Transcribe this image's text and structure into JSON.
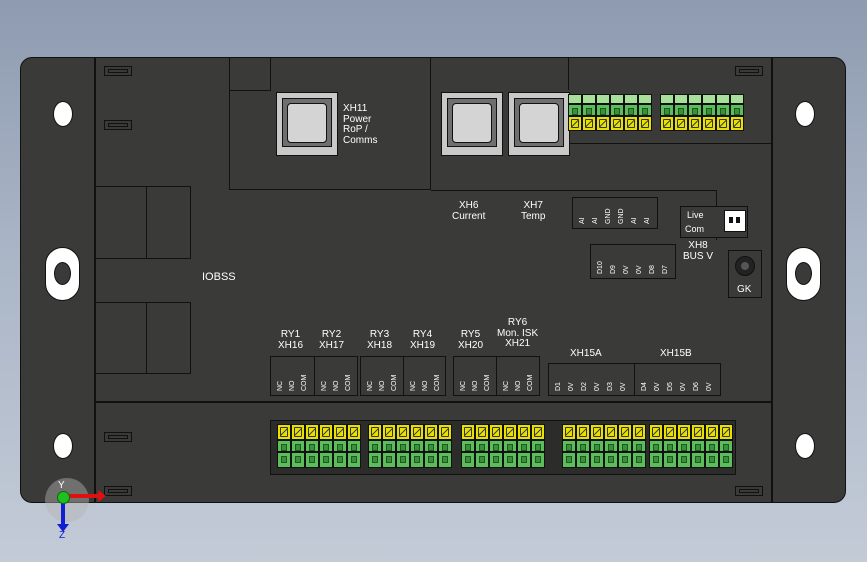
{
  "board": {
    "label_ioboard": "IOBSS"
  },
  "rj": {
    "xh11": [
      "XH11",
      "Power",
      "RoP /",
      "Comms"
    ],
    "xh6": [
      "XH6",
      "Current"
    ],
    "xh7": [
      "XH7",
      "Temp"
    ]
  },
  "conn": {
    "live": "Live",
    "com": "Com",
    "xh8": [
      "XH8",
      "BUS V"
    ],
    "gk": "GK",
    "ai_pins": [
      "AI",
      "AI",
      "GND",
      "GND",
      "AI",
      "AI"
    ],
    "d_pins": [
      "D10",
      "D9",
      "0V",
      "0V",
      "D8",
      "D7"
    ]
  },
  "relays": {
    "ry1": [
      "RY1",
      "XH16"
    ],
    "ry2": [
      "RY2",
      "XH17"
    ],
    "ry3": [
      "RY3",
      "XH18"
    ],
    "ry4": [
      "RY4",
      "XH19"
    ],
    "ry5": [
      "RY5",
      "XH20"
    ],
    "ry6": [
      "RY6",
      "Mon. ISK",
      "XH21"
    ],
    "pins": [
      "NC",
      "NO",
      "COM"
    ],
    "xh15a": "XH15A",
    "xh15b": "XH15B",
    "xh15a_pins": [
      "D1",
      "0V",
      "D2",
      "0V",
      "D3",
      "0V"
    ],
    "xh15b_pins": [
      "D4",
      "0V",
      "D5",
      "0V",
      "D6",
      "0V"
    ]
  },
  "axes": {
    "y": "Y",
    "z": "Z"
  }
}
